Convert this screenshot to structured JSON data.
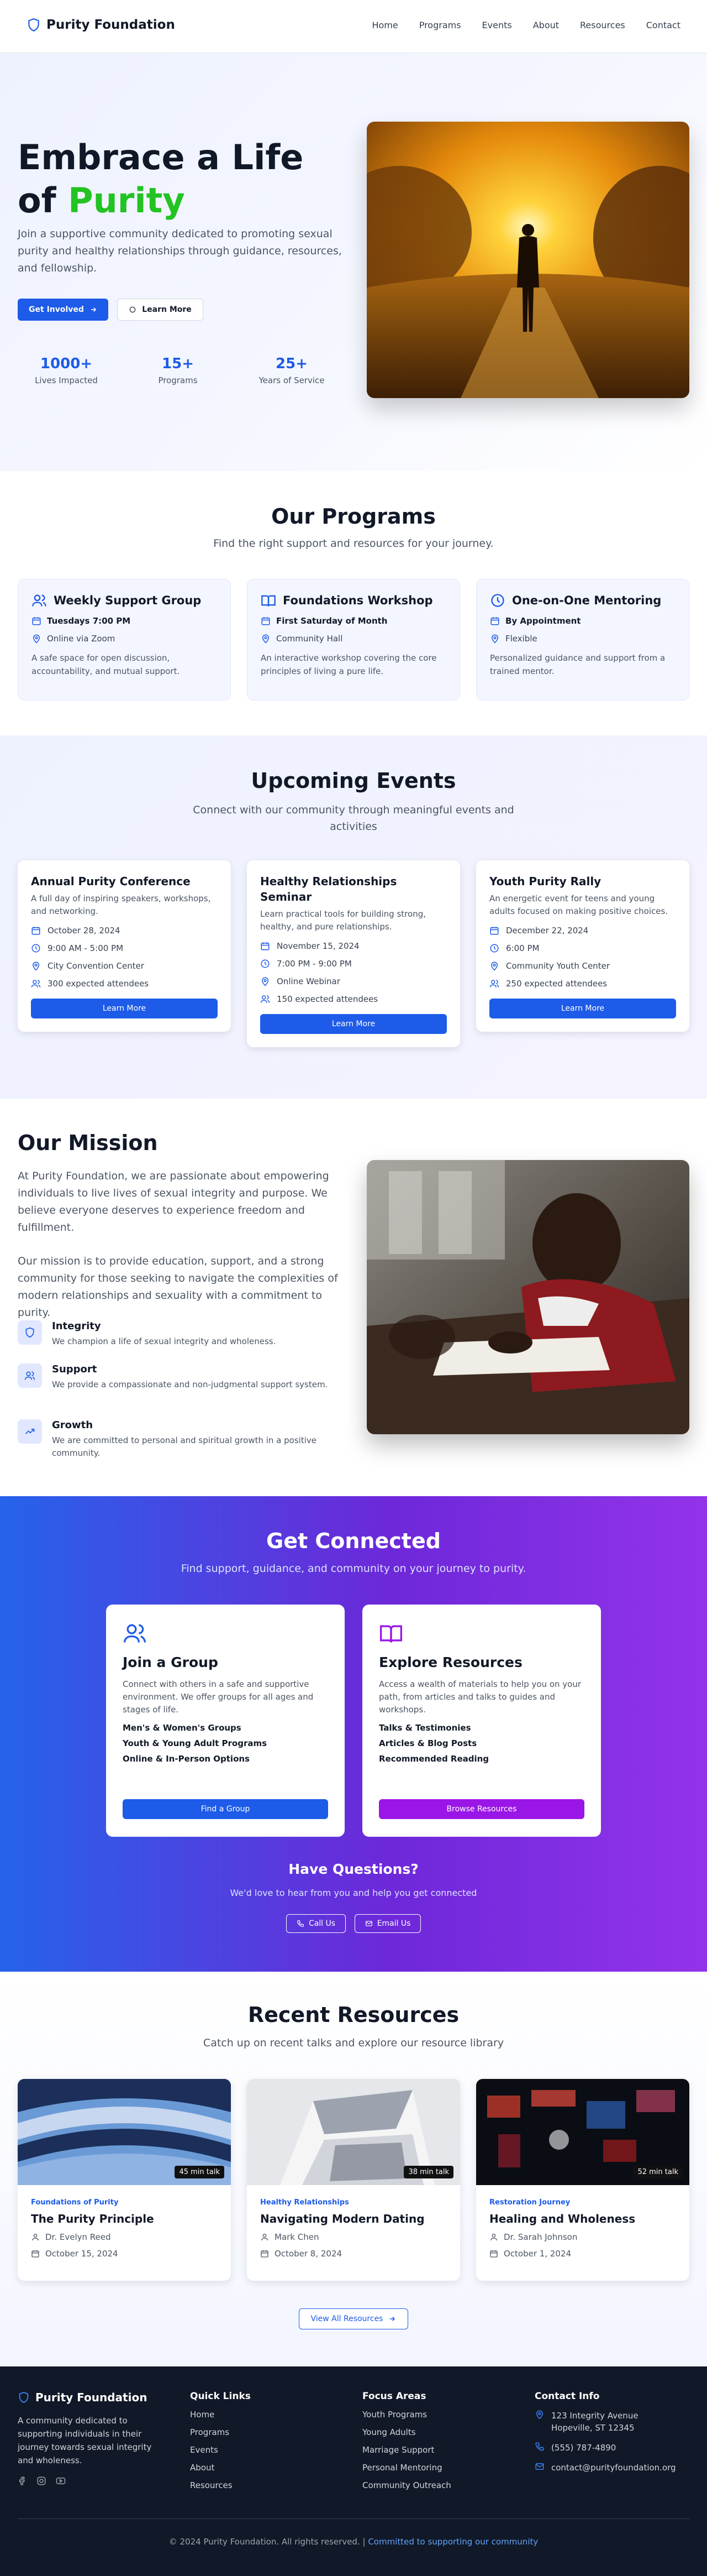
{
  "nav": {
    "brand": "Purity Foundation",
    "links": [
      "Home",
      "Programs",
      "Events",
      "About",
      "Resources",
      "Contact"
    ]
  },
  "hero": {
    "title_line1": "Embrace a Life",
    "title_of": "of",
    "title_accent": "Purity",
    "description": "Join a supportive community dedicated to promoting sexual purity and healthy relationships through guidance, resources, and fellowship.",
    "primary_button": "Get Involved",
    "secondary_button": "Learn More",
    "stats": [
      {
        "value": "1000+",
        "label": "Lives Impacted"
      },
      {
        "value": "15+",
        "label": "Programs"
      },
      {
        "value": "25+",
        "label": "Years of Service"
      }
    ]
  },
  "programs": {
    "title": "Our Programs",
    "subtitle": "Find the right support and resources for your journey.",
    "items": [
      {
        "title": "Weekly Support Group",
        "when": "Tuesdays 7:00 PM",
        "where": "Online via Zoom",
        "desc": "A safe space for open discussion, accountability, and mutual support.",
        "icon": "users-icon"
      },
      {
        "title": "Foundations Workshop",
        "when": "First Saturday of Month",
        "where": "Community Hall",
        "desc": "An interactive workshop covering the core principles of living a pure life.",
        "icon": "book-icon"
      },
      {
        "title": "One-on-One Mentoring",
        "when": "By Appointment",
        "where": "Flexible",
        "desc": "Personalized guidance and support from a trained mentor.",
        "icon": "clock-icon"
      }
    ]
  },
  "events": {
    "title": "Upcoming Events",
    "subtitle": "Connect with our community through meaningful events and activities",
    "items": [
      {
        "title": "Annual Purity Conference",
        "desc": "A full day of inspiring speakers, workshops, and networking.",
        "date": "October 28, 2024",
        "time": "9:00 AM - 5:00 PM",
        "location": "City Convention Center",
        "attendees": "300 expected attendees",
        "button": "Learn More"
      },
      {
        "title": "Healthy Relationships Seminar",
        "desc": "Learn practical tools for building strong, healthy, and pure relationships.",
        "date": "November 15, 2024",
        "time": "7:00 PM - 9:00 PM",
        "location": "Online Webinar",
        "attendees": "150 expected attendees",
        "button": "Learn More"
      },
      {
        "title": "Youth Purity Rally",
        "desc": "An energetic event for teens and young adults focused on making positive choices.",
        "date": "December 22, 2024",
        "time": "6:00 PM",
        "location": "Community Youth Center",
        "attendees": "250 expected attendees",
        "button": "Learn More"
      }
    ]
  },
  "mission": {
    "title": "Our Mission",
    "p1": "At Purity Foundation, we are passionate about empowering individuals to live lives of sexual integrity and purpose. We believe everyone deserves to experience freedom and fulfillment.",
    "p2": "Our mission is to provide education, support, and a strong community for those seeking to navigate the complexities of modern relationships and sexuality with a commitment to purity.",
    "values": [
      {
        "title": "Integrity",
        "desc": "We champion a life of sexual integrity and wholeness.",
        "icon": "shield-icon"
      },
      {
        "title": "Support",
        "desc": "We provide a compassionate and non-judgmental support system.",
        "icon": "users-icon"
      },
      {
        "title": "Growth",
        "desc": "We are committed to personal and spiritual growth in a positive community.",
        "icon": "trending-up-icon"
      }
    ]
  },
  "connect": {
    "title": "Get Connected",
    "subtitle": "Find support, guidance, and community on your journey to purity.",
    "cards": [
      {
        "title": "Join a Group",
        "desc": "Connect with others in a safe and supportive environment. We offer groups for all ages and stages of life.",
        "items": [
          "Men's & Women's Groups",
          "Youth & Young Adult Programs",
          "Online & In-Person Options"
        ],
        "button": "Find a Group",
        "color": "#1d5be8",
        "icon": "users-icon"
      },
      {
        "title": "Explore Resources",
        "desc": "Access a wealth of materials to help you on your path, from articles and talks to guides and workshops.",
        "items": [
          "Talks & Testimonies",
          "Articles & Blog Posts",
          "Recommended Reading"
        ],
        "button": "Browse Resources",
        "color": "#9a16e6",
        "icon": "book-open-icon"
      }
    ],
    "questions_title": "Have Questions?",
    "questions_sub": "We'd love to hear from you and help you get connected",
    "call_button": "Call Us",
    "email_button": "Email Us"
  },
  "resources": {
    "title": "Recent Resources",
    "subtitle": "Catch up on recent talks and explore our resource library",
    "items": [
      {
        "category": "Foundations of Purity",
        "title": "The Purity Principle",
        "author": "Dr. Evelyn Reed",
        "date": "October 15, 2024",
        "duration": "45 min talk",
        "color": "#1d5be8"
      },
      {
        "category": "Healthy Relationships",
        "title": "Navigating Modern Dating",
        "author": "Mark Chen",
        "date": "October 8, 2024",
        "duration": "38 min talk",
        "color": "#1d5be8"
      },
      {
        "category": "Restoration Journey",
        "title": "Healing and Wholeness",
        "author": "Dr. Sarah Johnson",
        "date": "October 1, 2024",
        "duration": "52 min talk",
        "color": "#1d5be8"
      }
    ],
    "view_all": "View All Resources"
  },
  "footer": {
    "brand": "Purity Foundation",
    "desc": "A community dedicated to supporting individuals in their journey towards sexual integrity and wholeness.",
    "quick_links_title": "Quick Links",
    "quick_links": [
      "Home",
      "Programs",
      "Events",
      "About",
      "Resources"
    ],
    "focus_title": "Focus Areas",
    "focus": [
      "Youth Programs",
      "Young Adults",
      "Marriage Support",
      "Personal Mentoring",
      "Community Outreach"
    ],
    "contact_title": "Contact Info",
    "address_line1": "123 Integrity Avenue",
    "address_line2": "Hopeville, ST 12345",
    "phone": "(555) 787-4890",
    "email": "contact@purityfoundation.org",
    "copyright": "© 2024 Purity Foundation. All rights reserved. |",
    "tagline": "Committed to supporting our community"
  }
}
